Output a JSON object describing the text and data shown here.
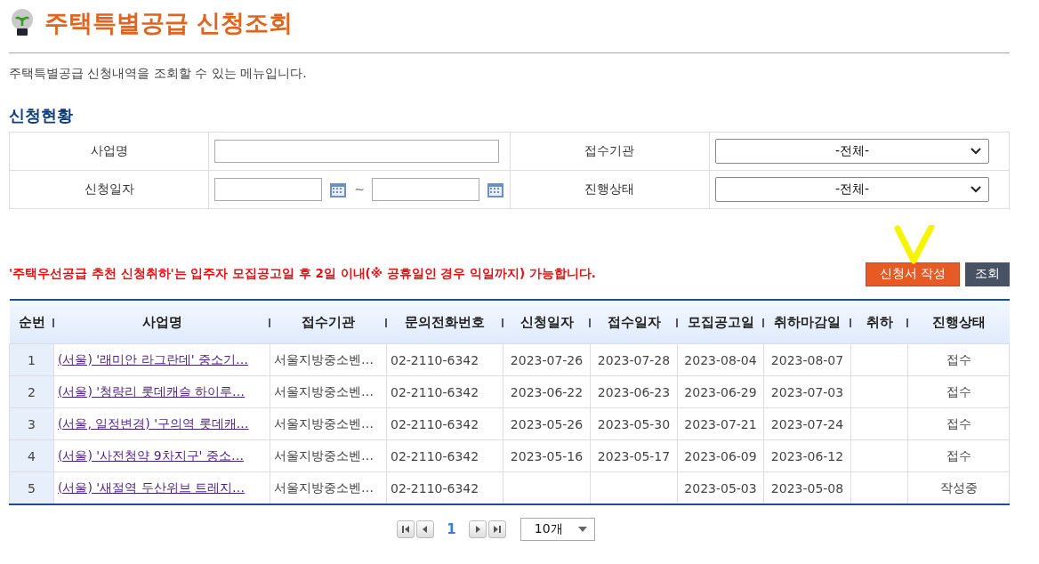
{
  "header": {
    "title": "주택특별공급 신청조회",
    "description": "주택특별공급 신청내역을 조회할 수 있는 메뉴입니다."
  },
  "section_title": "신청현황",
  "search": {
    "business_name_label": "사업명",
    "agency_label": "접수기관",
    "agency_value": "-전체-",
    "date_label": "신청일자",
    "date_separator": "~",
    "status_label": "진행상태",
    "status_value": "-전체-"
  },
  "notice": "'주택우선공급 추천 신청취하'는 입주자 모집공고일 후 2일 이내(※ 공휴일인 경우 익일까지) 가능합니다.",
  "buttons": [
    {
      "label": "신청서 작성",
      "kind": "primary"
    },
    {
      "label": "조회",
      "kind": "dark"
    }
  ],
  "table": {
    "columns": [
      "순번",
      "사업명",
      "접수기관",
      "문의전화번호",
      "신청일자",
      "접수일자",
      "모집공고일",
      "취하마감일",
      "취하",
      "진행상태"
    ],
    "rows": [
      {
        "no": "1",
        "name": "(서울) '래미안 라그란데' 중소기…",
        "agency": "서울지방중소벤…",
        "phone": "02-2110-6342",
        "applied": "2023-07-26",
        "received": "2023-07-28",
        "announced": "2023-08-04",
        "deadline": "2023-08-07",
        "status": "접수"
      },
      {
        "no": "2",
        "name": "(서울) '청량리 롯데캐슬 하이루…",
        "agency": "서울지방중소벤…",
        "phone": "02-2110-6342",
        "applied": "2023-06-22",
        "received": "2023-06-23",
        "announced": "2023-06-29",
        "deadline": "2023-07-03",
        "status": "접수"
      },
      {
        "no": "3",
        "name": "(서울, 일정변경) '구의역 롯데캐…",
        "agency": "서울지방중소벤…",
        "phone": "02-2110-6342",
        "applied": "2023-05-26",
        "received": "2023-05-30",
        "announced": "2023-07-21",
        "deadline": "2023-07-24",
        "status": "접수"
      },
      {
        "no": "4",
        "name": "(서울) '사전청약 9차지구' 중소…",
        "agency": "서울지방중소벤…",
        "phone": "02-2110-6342",
        "applied": "2023-05-16",
        "received": "2023-05-17",
        "announced": "2023-06-09",
        "deadline": "2023-06-12",
        "status": "접수"
      },
      {
        "no": "5",
        "name": "(서울) '새절역 두산위브 트레지…",
        "agency": "서울지방중소벤…",
        "phone": "02-2110-6342",
        "announced": "2023-05-03",
        "deadline": "2023-05-08",
        "status": "작성중"
      }
    ]
  },
  "pagination": {
    "pages": [
      {
        "label": "1",
        "selected": true
      }
    ],
    "page_size": "10개"
  }
}
